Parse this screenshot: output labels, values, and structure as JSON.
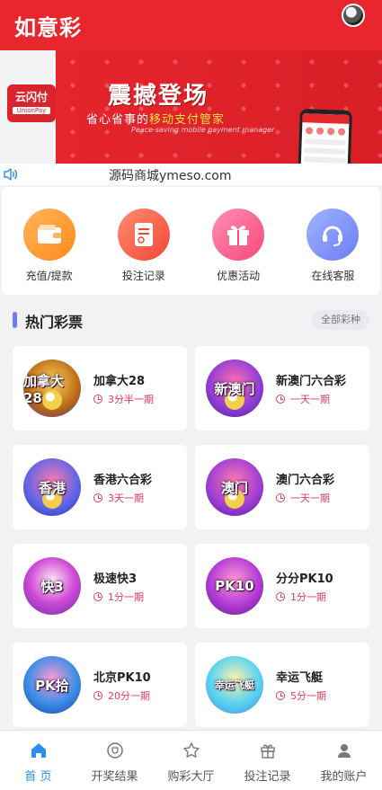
{
  "header": {
    "title": "如意彩"
  },
  "banner": {
    "logo_text": "云闪付",
    "logo_sub": "UnionPay",
    "headline": "震撼登场",
    "sub_prefix": "省心省事的",
    "sub_highlight": "移动支付管家",
    "sub_en": "Peace-saving mobile payment manager"
  },
  "notice": {
    "text": "源码商城ymeso.com"
  },
  "quick_actions": [
    {
      "label": "充值/提款",
      "icon": "wallet-icon"
    },
    {
      "label": "投注记录",
      "icon": "document-icon"
    },
    {
      "label": "优惠活动",
      "icon": "gift-icon"
    },
    {
      "label": "在线客服",
      "icon": "headset-icon"
    }
  ],
  "section": {
    "title": "热门彩票",
    "all_label": "全部彩种"
  },
  "games": [
    {
      "name": "加拿大28",
      "period": "3分半一期",
      "logo_text": "加拿大28"
    },
    {
      "name": "新澳门六合彩",
      "period": "一天一期",
      "logo_text": "新澳门"
    },
    {
      "name": "香港六合彩",
      "period": "3天一期",
      "logo_text": "香港"
    },
    {
      "name": "澳门六合彩",
      "period": "一天一期",
      "logo_text": "澳门"
    },
    {
      "name": "极速快3",
      "period": "1分一期",
      "logo_text": "快3"
    },
    {
      "name": "分分PK10",
      "period": "1分一期",
      "logo_text": "PK10"
    },
    {
      "name": "北京PK10",
      "period": "20分一期",
      "logo_text": "PK拾"
    },
    {
      "name": "幸运飞艇",
      "period": "5分一期",
      "logo_text": "幸运飞艇"
    }
  ],
  "bottom_nav": [
    {
      "label": "首 页",
      "icon": "home-icon",
      "active": true
    },
    {
      "label": "开奖结果",
      "icon": "trophy-icon",
      "active": false
    },
    {
      "label": "购彩大厅",
      "icon": "star-icon",
      "active": false
    },
    {
      "label": "投注记录",
      "icon": "gift-box-icon",
      "active": false
    },
    {
      "label": "我的账户",
      "icon": "user-icon",
      "active": false
    }
  ],
  "colors": {
    "primary": "#e8262d",
    "accent": "#6b7df5",
    "nav_active": "#2d8cf0",
    "period": "#e53b5c"
  }
}
